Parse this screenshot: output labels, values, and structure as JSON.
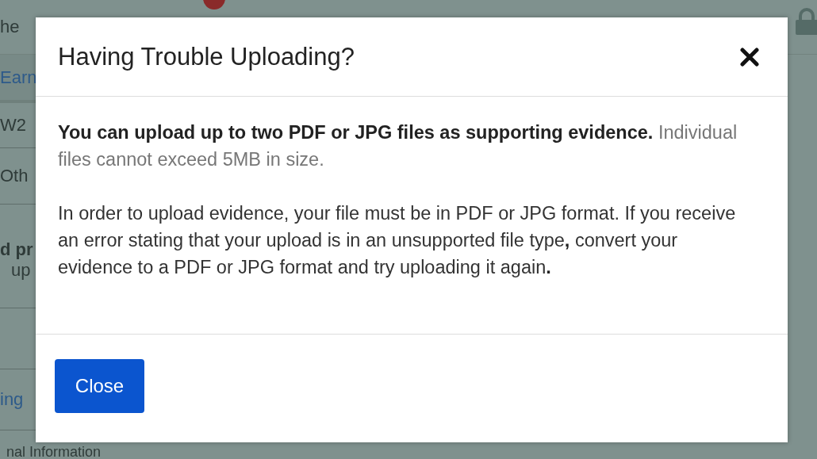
{
  "background": {
    "header_text": "he",
    "fragments": [
      {
        "text": "Earn",
        "kind": "link"
      },
      {
        "text": "W2",
        "kind": "plain"
      },
      {
        "text": "Oth",
        "kind": "plain"
      },
      {
        "text": "d pr",
        "kind": "bold"
      },
      {
        "text": "up",
        "kind": "plain"
      },
      {
        "text": "ing",
        "kind": "link"
      }
    ],
    "section_heading": "nal Information"
  },
  "modal": {
    "title": "Having Trouble Uploading?",
    "paragraphs": [
      "**You can upload up to two PDF or JPG files as supporting evidence.** Individual files cannot exceed 5MB in size.",
      "In order to upload evidence, your file must be in PDF or JPG format. If you receive an error stating that your upload is in an unsupported file type**,** convert your evidence to a PDF or JPG format and try uploading it again**.**"
    ],
    "button": "Close"
  }
}
